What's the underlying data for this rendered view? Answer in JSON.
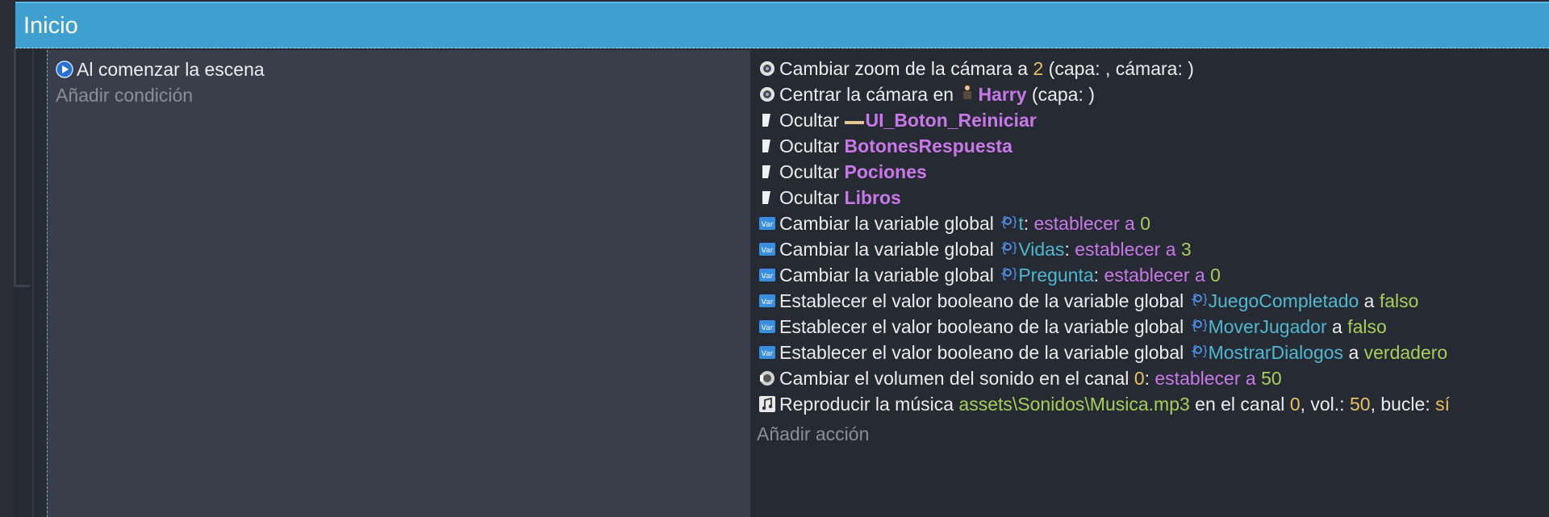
{
  "header": {
    "title": "Inicio"
  },
  "conditions": {
    "trigger": "Al comenzar la escena",
    "add_condition": "Añadir condición"
  },
  "actions": {
    "a1": {
      "text1": "Cambiar zoom de la cámara a ",
      "value": "2",
      "text2": " (capa: , cámara: )"
    },
    "a2": {
      "text1": "Centrar la cámara en ",
      "object": "Harry",
      "text2": " (capa: )"
    },
    "a3": {
      "text1": "Ocultar ",
      "object": "UI_Boton_Reiniciar"
    },
    "a4": {
      "text1": "Ocultar ",
      "object": "BotonesRespuesta"
    },
    "a5": {
      "text1": "Ocultar ",
      "object": "Pociones"
    },
    "a6": {
      "text1": "Ocultar ",
      "object": "Libros"
    },
    "a7": {
      "text1": "Cambiar la variable global ",
      "var": "t",
      "sep": ": ",
      "op": "establecer a",
      "value": "0"
    },
    "a8": {
      "text1": "Cambiar la variable global ",
      "var": "Vidas",
      "sep": ": ",
      "op": "establecer a",
      "value": "3"
    },
    "a9": {
      "text1": "Cambiar la variable global ",
      "var": "Pregunta",
      "sep": ": ",
      "op": "establecer a",
      "value": "0"
    },
    "a10": {
      "text1": "Establecer el valor booleano de la variable global ",
      "var": "JuegoCompletado",
      "mid": " a ",
      "value": "falso"
    },
    "a11": {
      "text1": "Establecer el valor booleano de la variable global ",
      "var": "MoverJugador",
      "mid": " a ",
      "value": "falso"
    },
    "a12": {
      "text1": "Establecer el valor booleano de la variable global ",
      "var": "MostrarDialogos",
      "mid": " a ",
      "value": "verdadero"
    },
    "a13": {
      "text1": "Cambiar el volumen del sonido en el canal ",
      "channel": "0",
      "sep": ": ",
      "op": "establecer a",
      "value": "50"
    },
    "a14": {
      "text1": "Reproducir la música ",
      "file": "assets\\Sonidos\\Musica.mp3",
      "t2": " en el canal ",
      "channel": "0",
      "t3": ", vol.: ",
      "vol": "50",
      "t4": ", bucle: ",
      "loop": "sí"
    },
    "add_action": "Añadir acción"
  },
  "icons": {
    "scene_start": "play-circle-icon",
    "camera": "camera-icon",
    "hide": "hide-object-icon",
    "variable": "variable-icon",
    "global_var": "global-variable-icon",
    "sound": "sound-volume-icon",
    "music": "music-icon"
  },
  "colors": {
    "header_bg": "#3fa0d0",
    "object_name": "#c978e8",
    "number": "#e8c060",
    "green_value": "#a6cf5a",
    "variable_name": "#4fb8d0"
  }
}
